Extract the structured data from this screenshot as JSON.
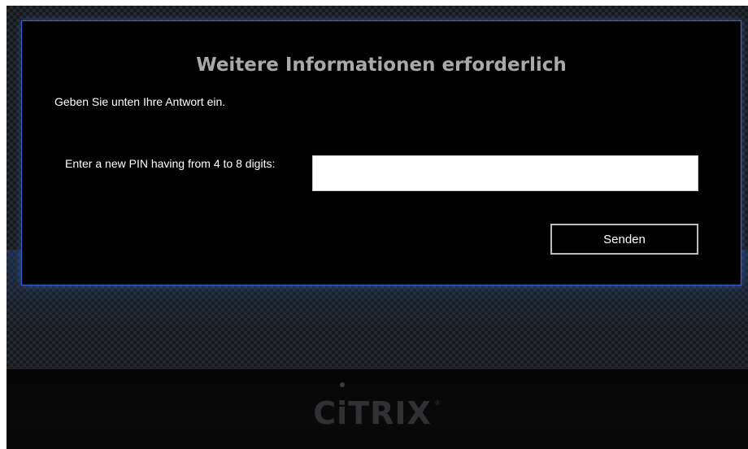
{
  "dialog": {
    "title": "Weitere Informationen erforderlich",
    "subtitle": "Geben Sie unten Ihre Antwort ein.",
    "prompt": "Enter a new PIN having from 4 to 8 digits:",
    "pin_value": "",
    "submit_label": "Senden"
  },
  "branding": {
    "logo_text": "CiTRIX",
    "registered_mark": "®",
    "accent_color": "#3a5fc0"
  }
}
